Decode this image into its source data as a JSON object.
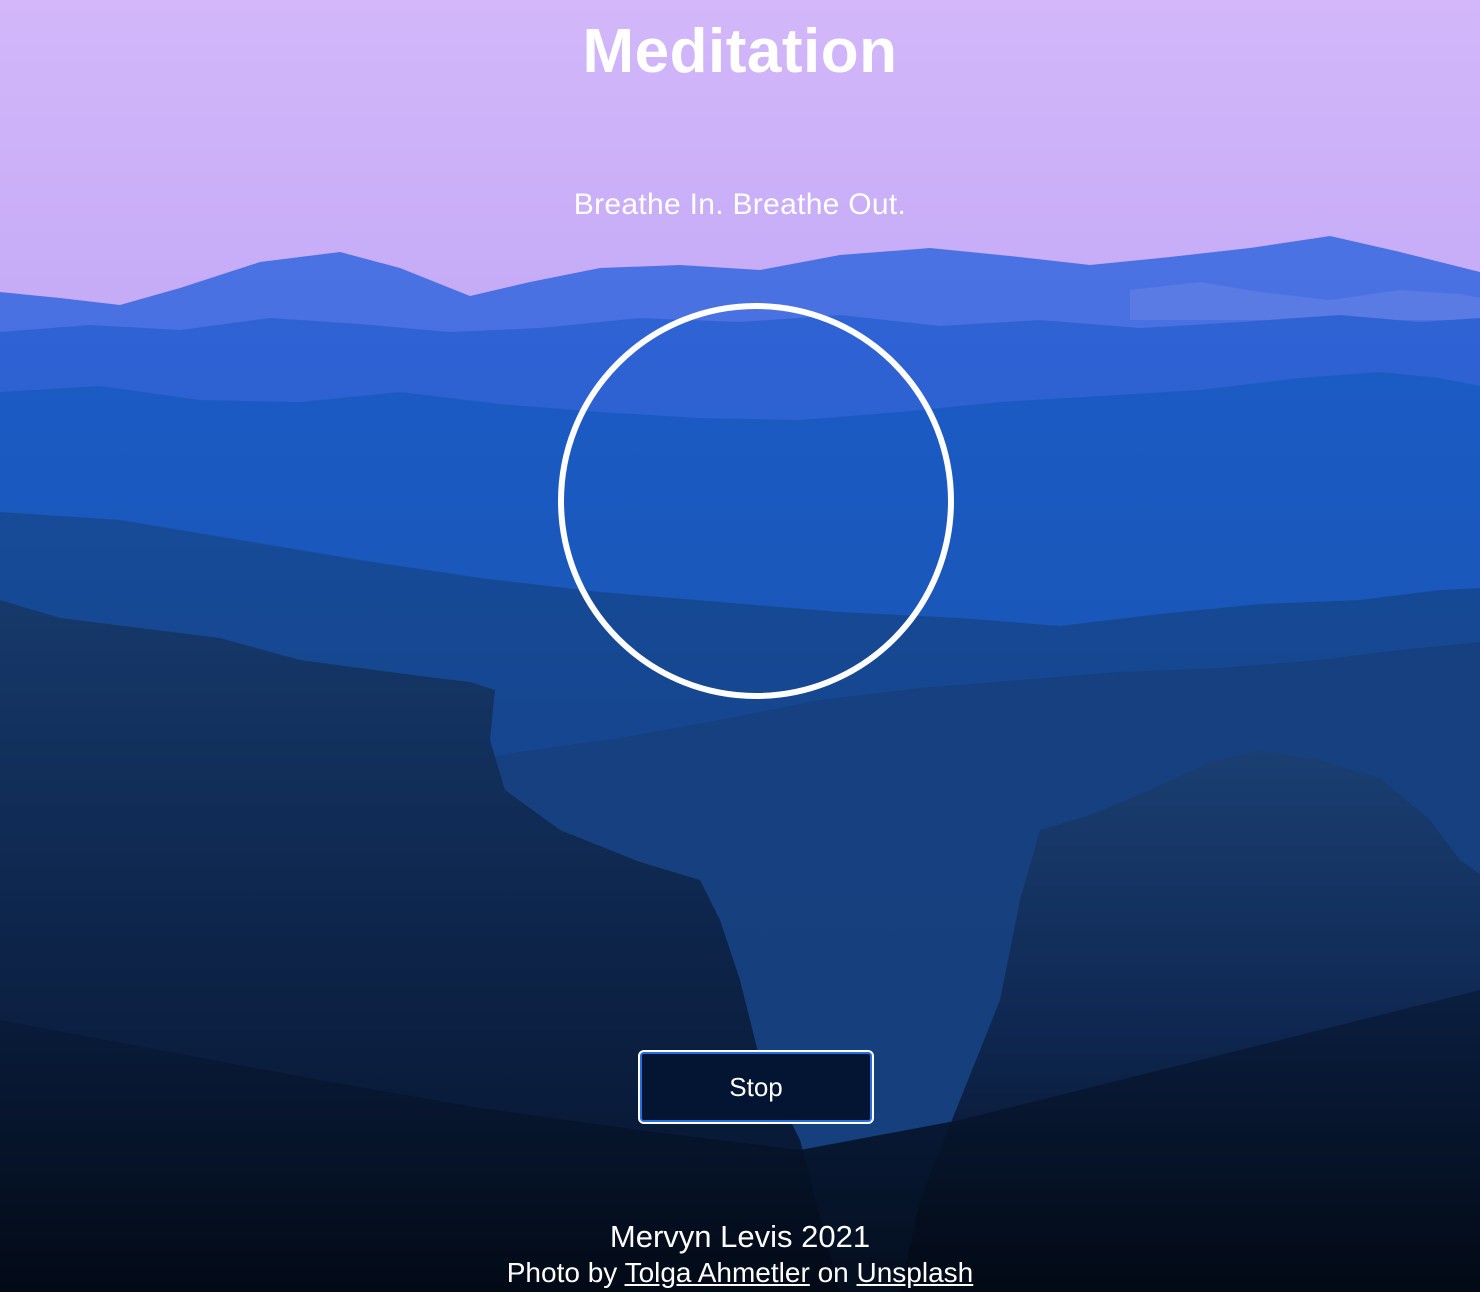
{
  "header": {
    "title": "Meditation",
    "instruction": "Breathe In. Breathe Out."
  },
  "controls": {
    "stop_label": "Stop"
  },
  "footer": {
    "author": "Mervyn Levis 2021",
    "credit_prefix": "Photo by",
    "photographer": "Tolga Ahmetler",
    "credit_middle": "on",
    "source": "Unsplash"
  },
  "colors": {
    "sky_top": "#d3b7fa",
    "mountains_far": "#4a6fe0",
    "mountains_near": "#0a1a3c",
    "button_bg": "#031533",
    "button_accent": "#2a6de0",
    "text": "#ffffff"
  }
}
